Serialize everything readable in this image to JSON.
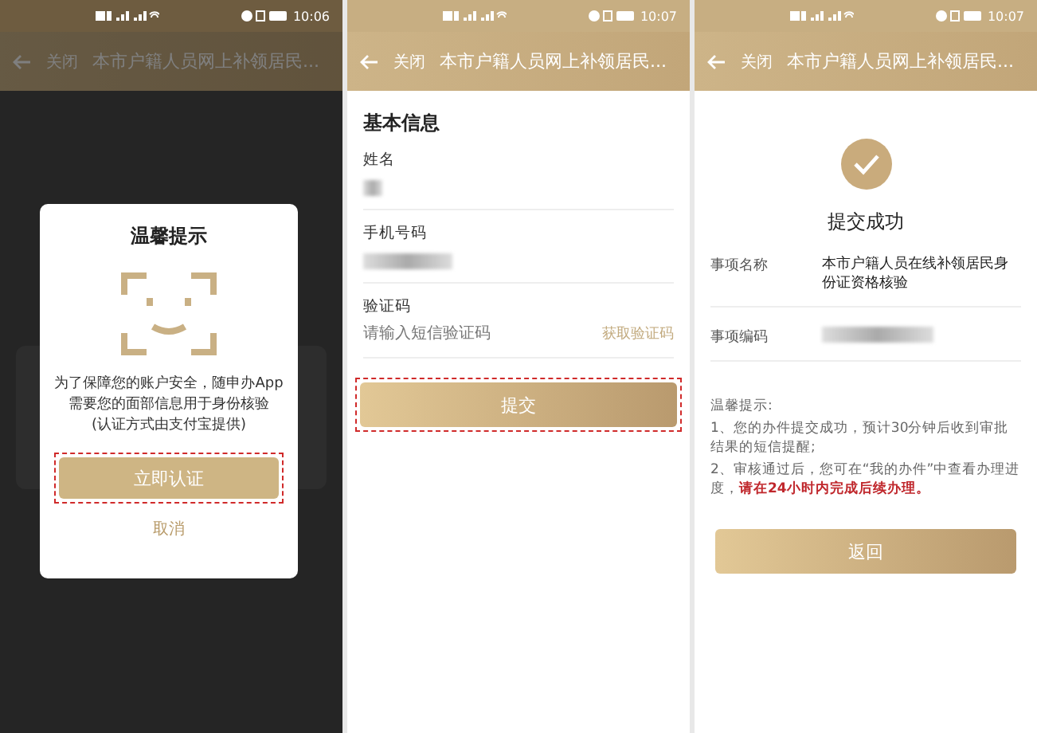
{
  "screens": [
    {
      "kind": "dialog",
      "status_bar": {
        "time": "10:06"
      },
      "header": {
        "close": "关闭",
        "title": "本市户籍人员网上补领居民..."
      },
      "dialog": {
        "title": "温馨提示",
        "message_lines": [
          "为了保障您的账户安全，随申办App",
          "需要您的面部信息用于身份核验",
          "(认证方式由支付宝提供)"
        ],
        "confirm": {
          "label": "立即认证",
          "highlighted": true
        },
        "cancel": "取消"
      }
    },
    {
      "kind": "form",
      "status_bar": {
        "time": "10:07"
      },
      "header": {
        "close": "关闭",
        "title": "本市户籍人员网上补领居民..."
      },
      "section_title": "基本信息",
      "fields": [
        {
          "kind": "redacted",
          "label": "姓名"
        },
        {
          "kind": "redacted",
          "label": "手机号码"
        },
        {
          "kind": "input",
          "label": "验证码",
          "placeholder": "请输入短信验证码",
          "action": "获取验证码"
        }
      ],
      "submit": {
        "label": "提交",
        "highlighted": true
      }
    },
    {
      "kind": "result",
      "status_bar": {
        "time": "10:07"
      },
      "header": {
        "close": "关闭",
        "title": "本市户籍人员网上补领居民..."
      },
      "result_title": "提交成功",
      "details": [
        {
          "kind": "text",
          "label": "事项名称",
          "value": "本市户籍人员在线补领居民身份证资格核验"
        },
        {
          "kind": "redacted",
          "label": "事项编码"
        }
      ],
      "notes_title": "温馨提示:",
      "notes": [
        "1、您的办件提交成功，预计30分钟后收到审批结果的短信提醒;",
        "2、审核通过后，您可在“我的办件”中查看办理进度，**请在24小时内完成后续办理。**"
      ],
      "back_button": {
        "label": "返回",
        "highlighted": false
      }
    }
  ]
}
